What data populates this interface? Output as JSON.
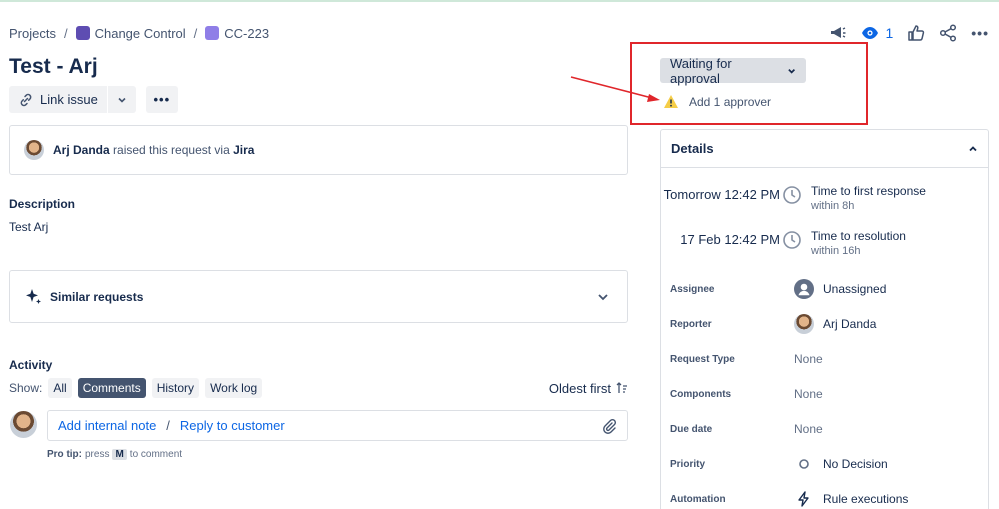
{
  "breadcrumb": {
    "projects": "Projects",
    "project": "Change Control",
    "issue_key": "CC-223"
  },
  "title": "Test - Arj",
  "toolbar": {
    "link_issue": "Link issue",
    "more": "•••"
  },
  "watch_count": "1",
  "request": {
    "reporter": "Arj Danda",
    "raised_text": "raised this request via",
    "source": "Jira"
  },
  "description": {
    "label": "Description",
    "text": "Test Arj"
  },
  "similar": {
    "label": "Similar requests"
  },
  "activity": {
    "label": "Activity",
    "show_label": "Show:",
    "filters": [
      "All",
      "Comments",
      "History",
      "Work log"
    ],
    "sort_label": "Oldest first",
    "internal_note": "Add internal note",
    "separator": "/",
    "reply": "Reply to customer",
    "protip_label": "Pro tip:",
    "protip_press": "press",
    "protip_key": "M",
    "protip_rest": "to comment"
  },
  "status": {
    "label": "Waiting for approval"
  },
  "approver": {
    "text": "Add 1 approver"
  },
  "details": {
    "header": "Details",
    "sla": [
      {
        "when": "Tomorrow 12:42 PM",
        "target": "Time to first response",
        "remaining": "within 8h"
      },
      {
        "when": "17 Feb 12:42 PM",
        "target": "Time to resolution",
        "remaining": "within 16h"
      }
    ],
    "fields": {
      "assignee": {
        "label": "Assignee",
        "value": "Unassigned"
      },
      "reporter": {
        "label": "Reporter",
        "value": "Arj Danda"
      },
      "request_type": {
        "label": "Request Type",
        "value": "None"
      },
      "components": {
        "label": "Components",
        "value": "None"
      },
      "due_date": {
        "label": "Due date",
        "value": "None"
      },
      "priority": {
        "label": "Priority",
        "value": "No Decision"
      },
      "automation": {
        "label": "Automation",
        "value": "Rule executions"
      }
    }
  },
  "colors": {
    "link": "#0c66e4",
    "annotation_red": "#e0262b",
    "warning": "#f5cd47",
    "selected_pill": "#44546f"
  }
}
